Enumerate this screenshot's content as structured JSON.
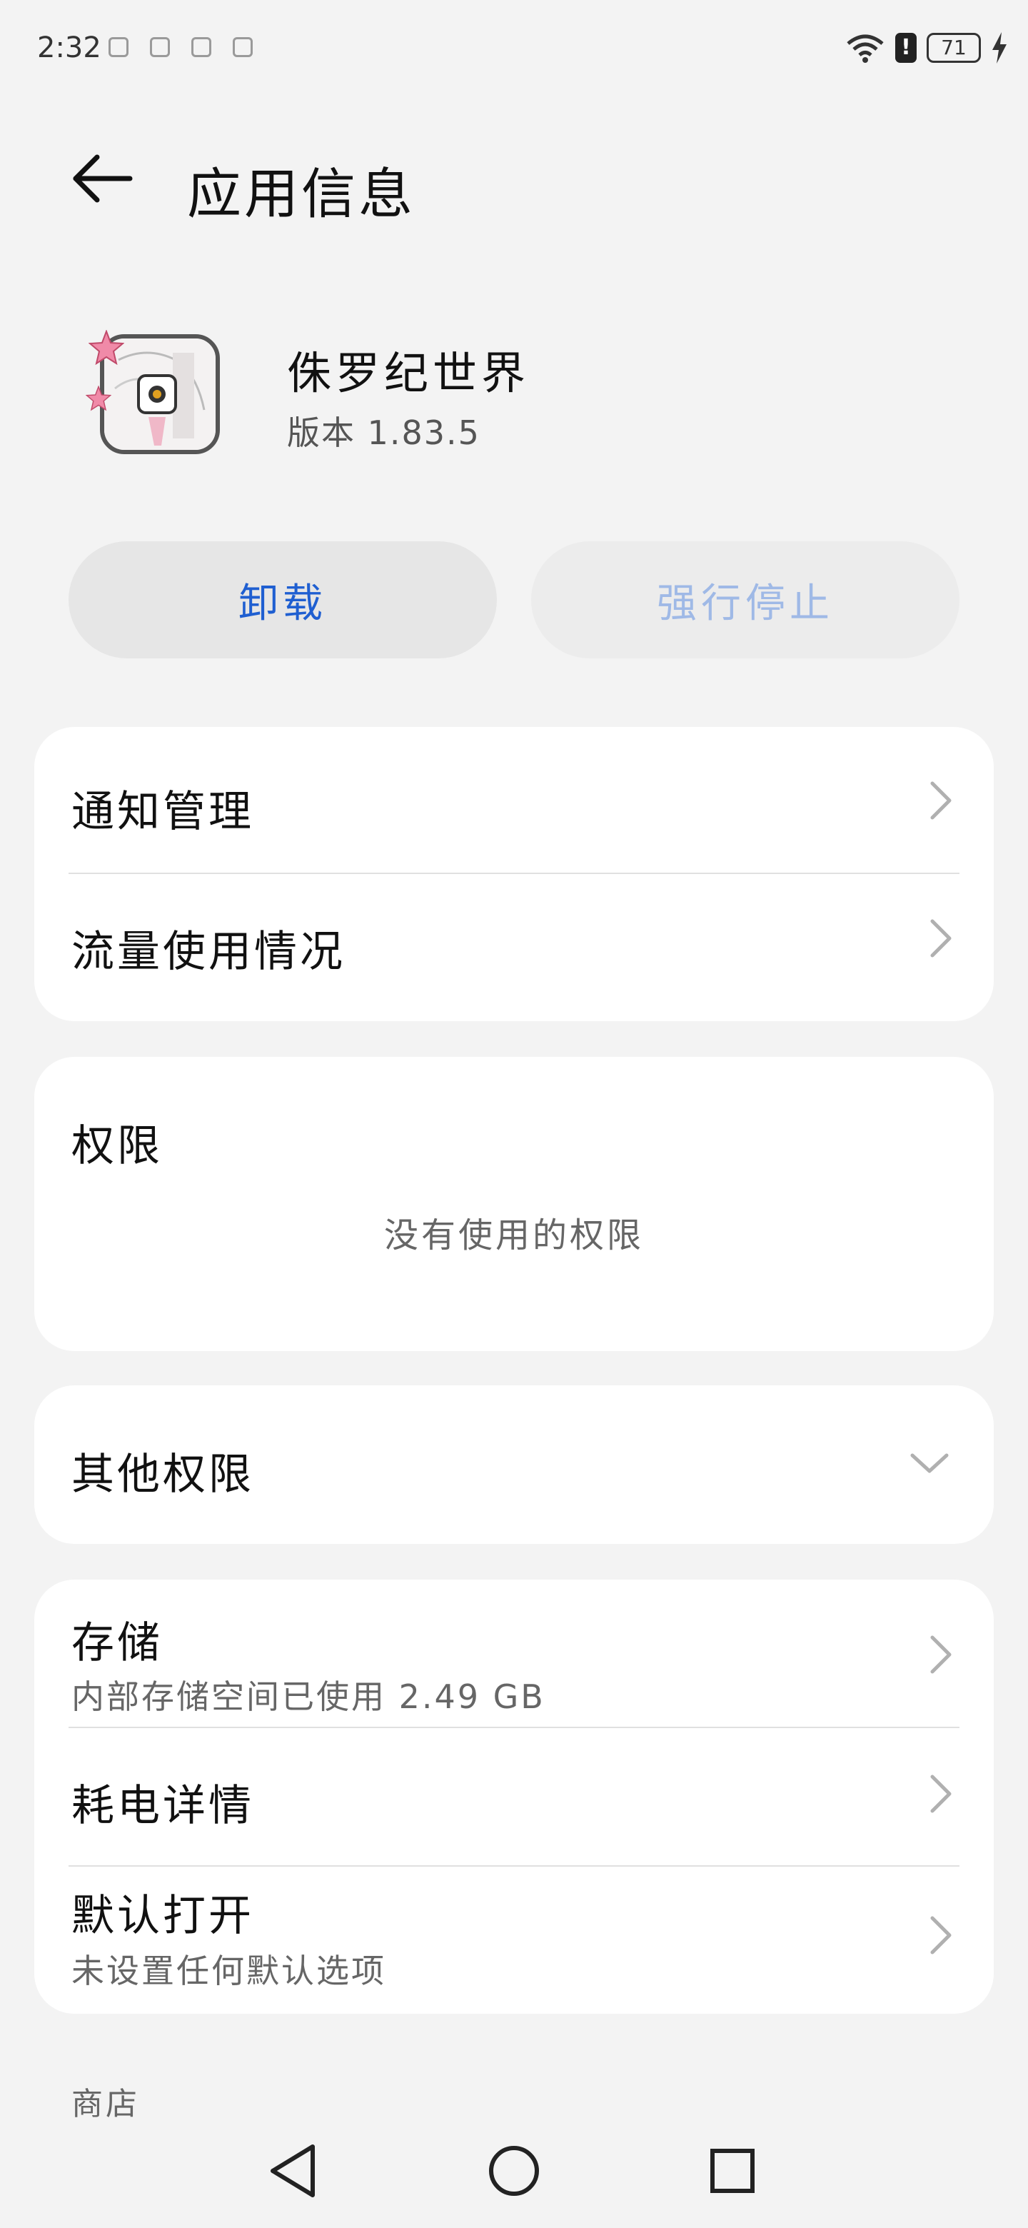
{
  "status_bar": {
    "time": "2:32",
    "battery": "71",
    "icons": [
      "notification-icon",
      "notification-icon",
      "notification-icon",
      "notification-icon",
      "wifi-icon",
      "alert-icon",
      "battery-icon",
      "charging-icon"
    ]
  },
  "header": {
    "title": "应用信息",
    "back_icon": "back-arrow-icon"
  },
  "app": {
    "name": "侏罗纪世界",
    "version": "版本 1.83.5"
  },
  "actions": {
    "uninstall": "卸载",
    "force_stop": "强行停止"
  },
  "card1": {
    "notifications": "通知管理",
    "data_usage": "流量使用情况"
  },
  "permissions": {
    "title": "权限",
    "empty_text": "没有使用的权限"
  },
  "other_permissions": {
    "title": "其他权限"
  },
  "card3": {
    "storage_title": "存储",
    "storage_sub": "内部存储空间已使用 2.49 GB",
    "battery_title": "耗电详情",
    "default_title": "默认打开",
    "default_sub": "未设置任何默认选项"
  },
  "store": {
    "label": "商店"
  },
  "colors": {
    "accent": "#1f5fd1",
    "disabled_accent": "#9fb9e6",
    "background": "#f3f3f3",
    "card": "#ffffff"
  }
}
